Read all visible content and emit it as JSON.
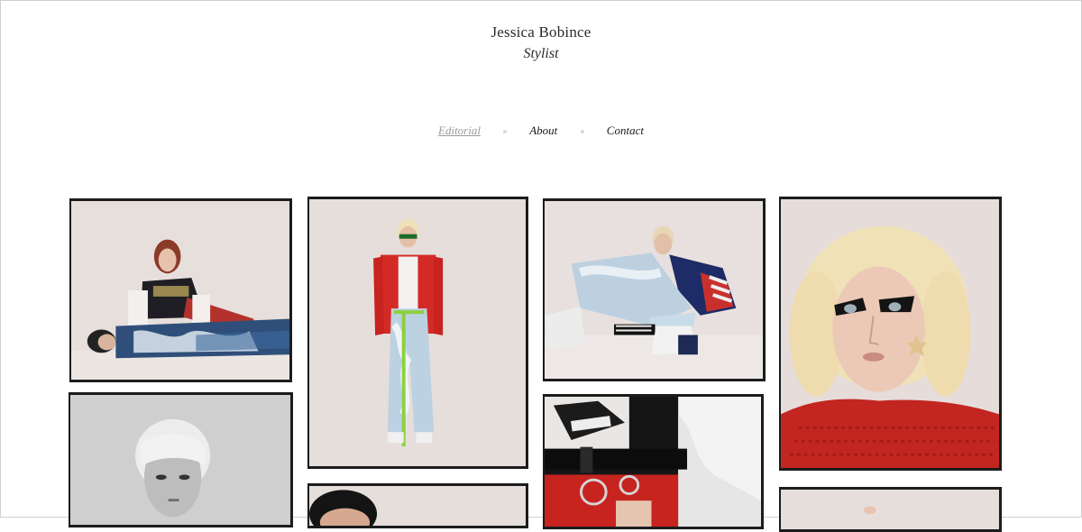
{
  "site": {
    "title": "Jessica Bobince",
    "subtitle": "Stylist"
  },
  "nav": {
    "items": [
      {
        "label": "Editorial",
        "active": true
      },
      {
        "label": "About",
        "active": false
      },
      {
        "label": "Contact",
        "active": false
      }
    ]
  },
  "gallery": {
    "photos": [
      {
        "id": "photo-1",
        "subject": "two models posing, one lying on floor"
      },
      {
        "id": "photo-2",
        "subject": "model in red jacket and bleached jeans"
      },
      {
        "id": "photo-3",
        "subject": "model seated in stars-and-stripes sweater"
      },
      {
        "id": "photo-4",
        "subject": "platinum blonde model with graphic eye makeup"
      },
      {
        "id": "photo-5",
        "subject": "black and white portrait"
      },
      {
        "id": "photo-6",
        "subject": "portrait, cropped"
      },
      {
        "id": "photo-7",
        "subject": "close-up of belt with ring hardware"
      },
      {
        "id": "photo-8",
        "subject": "portrait, cropped"
      }
    ]
  },
  "colors": {
    "text": "#2b2b2b",
    "nav_active": "#9a9a9a",
    "photo_border": "#1c1c1c",
    "backdrop": "#e6dedb"
  }
}
